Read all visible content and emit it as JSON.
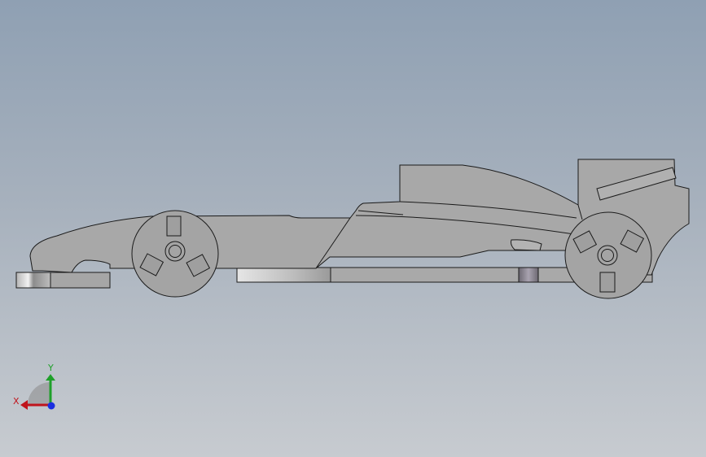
{
  "viewport": {
    "background_top": "#8fa0b3",
    "background_bottom": "#c7cbd0"
  },
  "model": {
    "body_color": "#a8a8a8",
    "outline_color": "#1a1a1a",
    "wheel_hub_color": "#a0a0a0"
  },
  "triad": {
    "x_label": "X",
    "y_label": "Y",
    "x_color": "#c0141c",
    "y_color": "#1fa02a",
    "z_color": "#1a2fe0"
  }
}
